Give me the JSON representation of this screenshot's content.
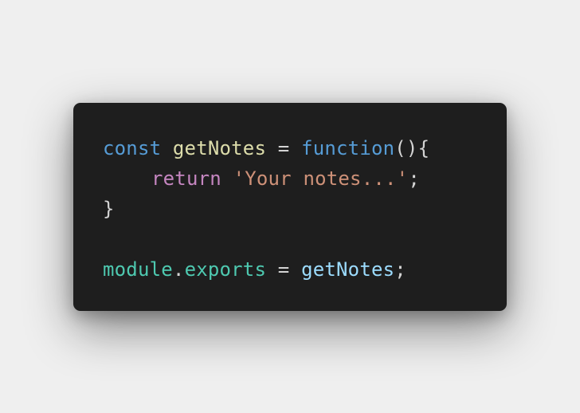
{
  "colors": {
    "background": "#efefef",
    "editor_background": "#1e1e1e",
    "keyword": "#569cd6",
    "function_name": "#dcdcaa",
    "control_keyword": "#c586c0",
    "string": "#ce9178",
    "module": "#4ec9b0",
    "variable": "#9cdcfe",
    "default_text": "#d4d4d4"
  },
  "code": {
    "line1": {
      "keyword": "const",
      "name": "getNotes",
      "equals": "=",
      "function_keyword": "function",
      "open": "(){"
    },
    "line2": {
      "keyword": "return",
      "string": "'Your notes...'",
      "semicolon": ";"
    },
    "line3": {
      "close": "}"
    },
    "line5": {
      "module": "module",
      "dot": ".",
      "exports": "exports",
      "equals": "=",
      "name": "getNotes",
      "semicolon": ";"
    }
  }
}
